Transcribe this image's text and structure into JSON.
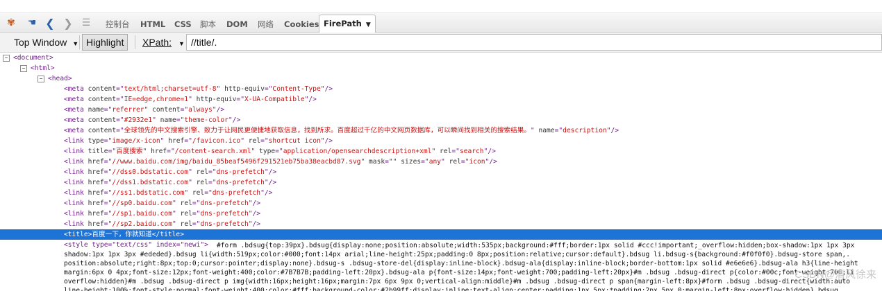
{
  "toolbar": {
    "tabs": [
      {
        "label": "控制台"
      },
      {
        "label": "HTML"
      },
      {
        "label": "CSS"
      },
      {
        "label": "脚本"
      },
      {
        "label": "DOM"
      },
      {
        "label": "网络"
      },
      {
        "label": "Cookies"
      },
      {
        "label": "FirePath"
      }
    ]
  },
  "firepath": {
    "frame_select": "Top Window",
    "highlight_label": "Highlight",
    "xpath_label": "XPath:",
    "xpath_value": "//title/."
  },
  "tree": {
    "document": "<document>",
    "html": "<html>",
    "head": "<head>",
    "nodes": [
      {
        "tag": "meta",
        "attrs": [
          [
            "content",
            "text/html;charset=utf-8"
          ],
          [
            "http-equiv",
            "Content-Type"
          ]
        ]
      },
      {
        "tag": "meta",
        "attrs": [
          [
            "content",
            "IE=edge,chrome=1"
          ],
          [
            "http-equiv",
            "X-UA-Compatible"
          ]
        ]
      },
      {
        "tag": "meta",
        "attrs": [
          [
            "name",
            "referrer"
          ],
          [
            "content",
            "always"
          ]
        ]
      },
      {
        "tag": "meta",
        "attrs": [
          [
            "content",
            "#2932e1"
          ],
          [
            "name",
            "theme-color"
          ]
        ]
      },
      {
        "tag": "meta",
        "attrs": [
          [
            "content",
            "全球领先的中文搜索引擎、致力于让网民更便捷地获取信息，找到所求。百度超过千亿的中文网页数据库，可以瞬间找到相关的搜索结果。"
          ],
          [
            "name",
            "description"
          ]
        ]
      },
      {
        "tag": "link",
        "attrs": [
          [
            "type",
            "image/x-icon"
          ],
          [
            "href",
            "/favicon.ico"
          ],
          [
            "rel",
            "shortcut icon"
          ]
        ]
      },
      {
        "tag": "link",
        "attrs": [
          [
            "title",
            "百度搜索"
          ],
          [
            "href",
            "/content-search.xml"
          ],
          [
            "type",
            "application/opensearchdescription+xml"
          ],
          [
            "rel",
            "search"
          ]
        ]
      },
      {
        "tag": "link",
        "attrs": [
          [
            "href",
            "//www.baidu.com/img/baidu_85beaf5496f291521eb75ba38eacbd87.svg"
          ],
          [
            "mask",
            ""
          ],
          [
            "sizes",
            "any"
          ],
          [
            "rel",
            "icon"
          ]
        ]
      },
      {
        "tag": "link",
        "attrs": [
          [
            "href",
            "//dss0.bdstatic.com"
          ],
          [
            "rel",
            "dns-prefetch"
          ]
        ]
      },
      {
        "tag": "link",
        "attrs": [
          [
            "href",
            "//dss1.bdstatic.com"
          ],
          [
            "rel",
            "dns-prefetch"
          ]
        ]
      },
      {
        "tag": "link",
        "attrs": [
          [
            "href",
            "//ss1.bdstatic.com"
          ],
          [
            "rel",
            "dns-prefetch"
          ]
        ]
      },
      {
        "tag": "link",
        "attrs": [
          [
            "href",
            "//sp0.baidu.com"
          ],
          [
            "rel",
            "dns-prefetch"
          ]
        ]
      },
      {
        "tag": "link",
        "attrs": [
          [
            "href",
            "//sp1.baidu.com"
          ],
          [
            "rel",
            "dns-prefetch"
          ]
        ]
      },
      {
        "tag": "link",
        "attrs": [
          [
            "href",
            "//sp2.baidu.com"
          ],
          [
            "rel",
            "dns-prefetch"
          ]
        ]
      }
    ],
    "title_node": "<title>百度一下，你就知道</title>",
    "style_open": "<style type=\"text/css\" index=\"newi\">",
    "css_lines": [
      "#form .bdsug{top:39px}.bdsug{display:none;position:absolute;width:535px;background:#fff;border:1px solid #ccc!important;_overflow:hidden;box-shadow:1px 1px 3px",
      "shadow:1px 1px 3px #ededed}.bdsug li{width:519px;color:#000;font:14px arial;line-height:25px;padding:0 8px;position:relative;cursor:default}.bdsug li.bdsug-s{background:#f0f0f0}.bdsug-store span,.",
      "position:absolute;right:8px;top:0;cursor:pointer;display:none}.bdsug-s .bdsug-store-del{display:inline-block}.bdsug-ala{display:inline-block;border-bottom:1px solid #e6e6e6}.bdsug-ala h3{line-height",
      "margin:6px 0 4px;font-size:12px;font-weight:400;color:#7B7B7B;padding-left:20px}.bdsug-ala p{font-size:14px;font-weight:700;padding-left:20px}#m .bdsug .bdsug-direct p{color:#00c;font-weight:700;li",
      "overflow:hidden}#m .bdsug .bdsug-direct p img{width:16px;height:16px;margin:7px 6px 9px 0;vertical-align:middle}#m .bdsug .bdsug-direct p span{margin-left:8px}#form .bdsug .bdsug-direct{width:auto",
      "line-height:100%;font-style:normal;font-weight:400;color:#fff;background-color:#2b99ff;display:inline;text-align:center;padding:1px 5px;*padding:2px 5px 0;margin-left:8px;overflow:hidden}.bdsug"
    ]
  },
  "watermark": "CSDN@清风徐来"
}
